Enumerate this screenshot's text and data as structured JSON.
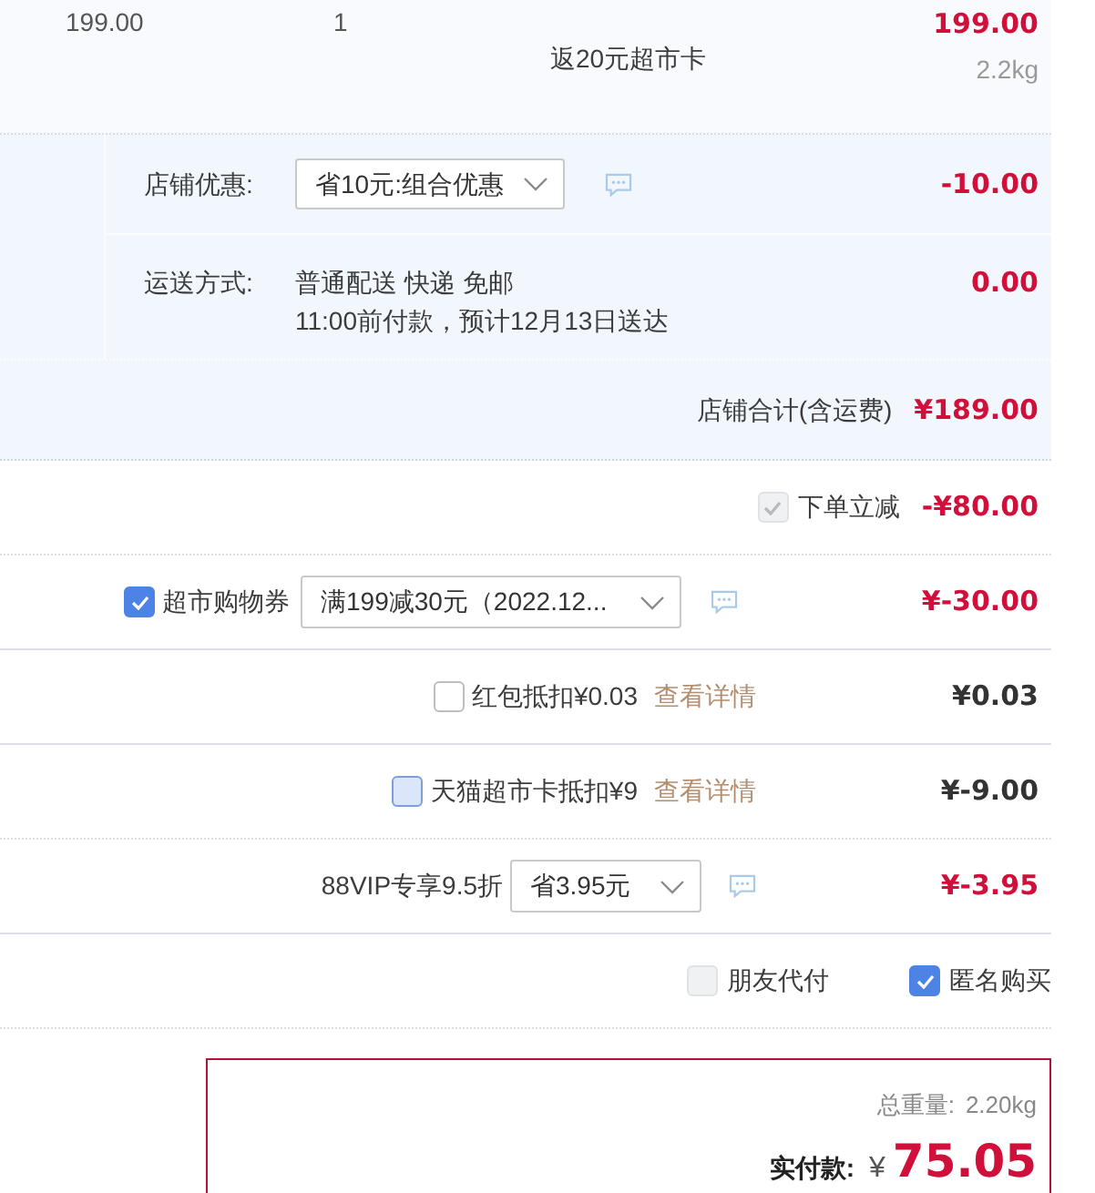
{
  "item": {
    "unit_price": "199.00",
    "quantity": "1",
    "promotion": "返20元超市卡",
    "subtotal": "199.00",
    "weight": "2.2kg"
  },
  "store": {
    "discount": {
      "label": "店铺优惠:",
      "choice": "省10元:组合优惠",
      "amount": "-10.00"
    },
    "shipping": {
      "label": "运送方式:",
      "lines": [
        "普通配送 快递 免邮",
        "11:00前付款，预计12月13日送达"
      ],
      "amount": "0.00"
    },
    "total": {
      "label": "店铺合计(含运费)",
      "amount": "¥189.00"
    }
  },
  "adjustments": [
    {
      "kind": "checkbox",
      "label": "下单立减",
      "checked": true,
      "disabled": true,
      "amount": "-¥80.00"
    },
    {
      "kind": "coupon",
      "label": "超市购物券",
      "checked": true,
      "disabled": false,
      "choice": "满199减30元（2022.12...",
      "amount": "¥-30.00"
    },
    {
      "kind": "deduction",
      "label": "红包抵扣¥0.03",
      "checked": false,
      "disabled": false,
      "focused": false,
      "link": "查看详情",
      "amount": "¥0.03"
    },
    {
      "kind": "deduction",
      "label": "天猫超市卡抵扣¥9",
      "checked": false,
      "disabled": false,
      "focused": true,
      "link": "查看详情",
      "amount": "¥-9.00"
    },
    {
      "kind": "select",
      "label": "88VIP专享9.5折",
      "choice": "省3.95元",
      "amount": "¥-3.95"
    }
  ],
  "options": [
    {
      "label": "朋友代付",
      "checked": false,
      "disabled": true
    },
    {
      "label": "匿名购买",
      "checked": true,
      "disabled": false
    }
  ],
  "payment": {
    "weight_label": "总重量:",
    "weight": "2.20kg",
    "label": "实付款:",
    "currency": "¥",
    "amount": "75.05"
  }
}
